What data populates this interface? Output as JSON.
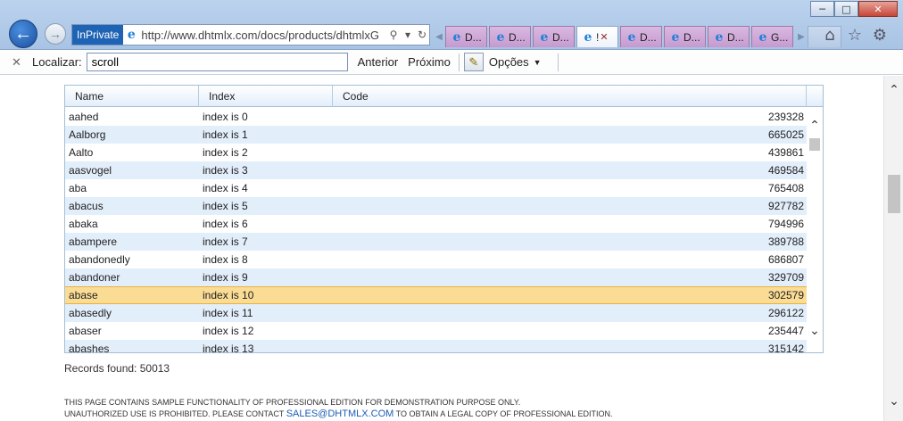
{
  "browser": {
    "inprivate": "InPrivate",
    "url": "http://www.dhtmlx.com/docs/products/dhtmlxG",
    "tabs": [
      {
        "label": "D..."
      },
      {
        "label": "D..."
      },
      {
        "label": "D..."
      },
      {
        "label": "!",
        "active": true,
        "close": "✕"
      },
      {
        "label": "D..."
      },
      {
        "label": "D..."
      },
      {
        "label": "D..."
      },
      {
        "label": "G..."
      }
    ]
  },
  "findbar": {
    "label": "Localizar:",
    "query": "scroll",
    "prev": "Anterior",
    "next": "Próximo",
    "options": "Opções"
  },
  "grid": {
    "columns": [
      "Name",
      "Index",
      "Code"
    ],
    "selected_row": 10,
    "rows": [
      {
        "name": "aahed",
        "index": "index is 0",
        "code": "239328"
      },
      {
        "name": "Aalborg",
        "index": "index is 1",
        "code": "665025"
      },
      {
        "name": "Aalto",
        "index": "index is 2",
        "code": "439861"
      },
      {
        "name": "aasvogel",
        "index": "index is 3",
        "code": "469584"
      },
      {
        "name": "aba",
        "index": "index is 4",
        "code": "765408"
      },
      {
        "name": "abacus",
        "index": "index is 5",
        "code": "927782"
      },
      {
        "name": "abaka",
        "index": "index is 6",
        "code": "794996"
      },
      {
        "name": "abampere",
        "index": "index is 7",
        "code": "389788"
      },
      {
        "name": "abandonedly",
        "index": "index is 8",
        "code": "686807"
      },
      {
        "name": "abandoner",
        "index": "index is 9",
        "code": "329709"
      },
      {
        "name": "abase",
        "index": "index is 10",
        "code": "302579"
      },
      {
        "name": "abasedly",
        "index": "index is 11",
        "code": "296122"
      },
      {
        "name": "abaser",
        "index": "index is 12",
        "code": "235447"
      },
      {
        "name": "abashes",
        "index": "index is 13",
        "code": "315142"
      }
    ]
  },
  "records": {
    "label": "Records found:",
    "count": "50013"
  },
  "footer": {
    "line1": "THIS PAGE CONTAINS SAMPLE FUNCTIONALITY OF PROFESSIONAL EDITION FOR DEMONSTRATION PURPOSE ONLY.",
    "line2_prefix": "UNAUTHORIZED USE IS PROHIBITED. PLEASE CONTACT ",
    "email": "SALES@DHTMLX.COM",
    "line2_suffix": " TO OBTAIN A LEGAL COPY OF PROFESSIONAL EDITION."
  }
}
